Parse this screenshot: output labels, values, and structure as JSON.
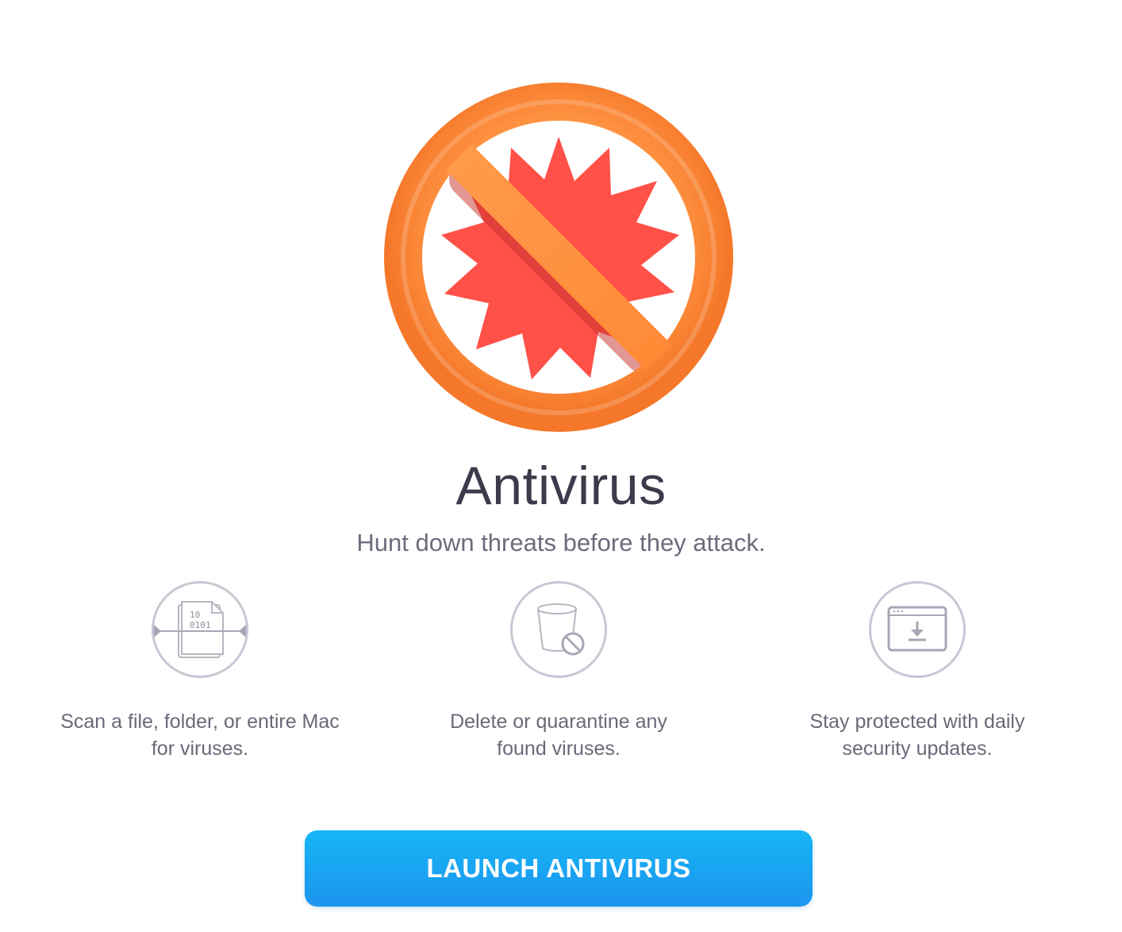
{
  "app": {
    "title": "Antivirus",
    "subtitle": "Hunt down threats before they attack.",
    "hero_icon": "no-virus-icon",
    "colors": {
      "ring_orange": "#ff8c3a",
      "virus_red": "#ff5148",
      "button_blue_top": "#16b6f6",
      "button_blue_bottom": "#1d94ee"
    }
  },
  "features": [
    {
      "icon": "scan-file-icon",
      "binary_top": "10",
      "binary_bottom": "0101",
      "line1": "Scan a file, folder, or entire Mac",
      "line2": "for viruses."
    },
    {
      "icon": "trash-block-icon",
      "line1": "Delete or quarantine any",
      "line2": "found viruses."
    },
    {
      "icon": "download-update-icon",
      "line1": "Stay protected with daily",
      "line2": "security updates."
    }
  ],
  "launch_button": {
    "label": "LAUNCH ANTIVIRUS"
  }
}
